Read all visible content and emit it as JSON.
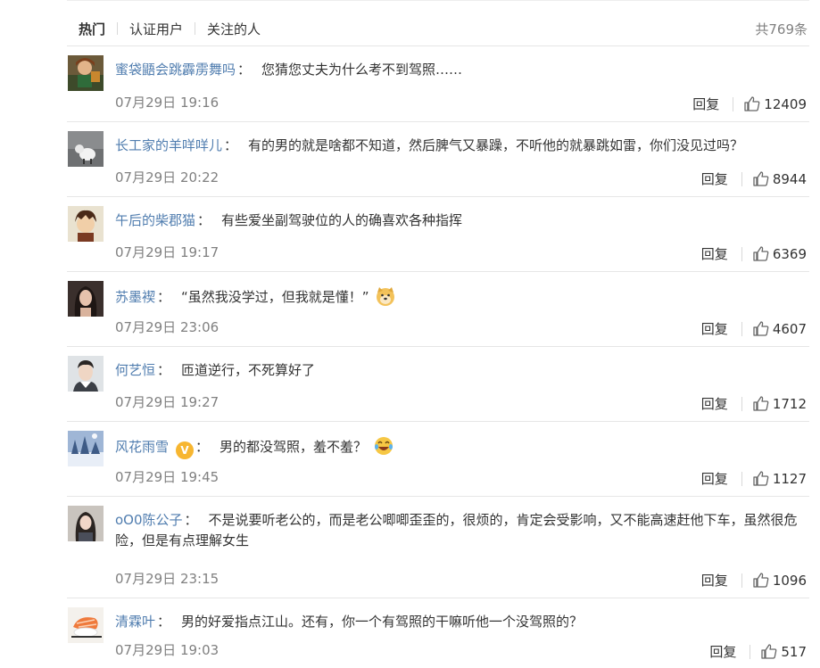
{
  "tabs": [
    {
      "label": "热门",
      "active": true
    },
    {
      "label": "认证用户",
      "active": false
    },
    {
      "label": "关注的人",
      "active": false
    }
  ],
  "total_count": "共769条",
  "reply_label": "回复",
  "comments": [
    {
      "user": "蜜袋鼯会跳霹雳舞吗",
      "colon": "：",
      "text": "您猜您丈夫为什么考不到驾照……",
      "time": "07月29日 19:16",
      "likes": "12409",
      "avatar": "illustrated-character-avatar"
    },
    {
      "user": "长工家的羊咩咩儿",
      "colon": "：",
      "text": "有的男的就是啥都不知道，然后脾气又暴躁，不听他的就暴跳如雷，你们没见过吗？",
      "time": "07月29日 20:22",
      "likes": "8944",
      "avatar": "sheep-figure-avatar"
    },
    {
      "user": "午后的柴郡猫",
      "colon": "：",
      "text": "有些爱坐副驾驶位的人的确喜欢各种指挥",
      "time": "07月29日 19:17",
      "likes": "6369",
      "avatar": "anime-boy-avatar"
    },
    {
      "user": "苏墨褉",
      "colon": "：",
      "text": "“虽然我没学过，但我就是懂！”",
      "time": "07月29日 23:06",
      "likes": "4607",
      "avatar": "woman-portrait-avatar",
      "emoji": "doge-emoji"
    },
    {
      "user": "何艺恒",
      "colon": "：",
      "text": "匝道逆行，不死算好了",
      "time": "07月29日 19:27",
      "likes": "1712",
      "avatar": "man-portrait-avatar"
    },
    {
      "user": "风花雨雪",
      "colon": "：",
      "text": "男的都没驾照，羞不羞？",
      "time": "07月29日 19:45",
      "likes": "1127",
      "avatar": "winter-forest-avatar",
      "verified_badge": "V",
      "emoji": "laughing-tears-emoji"
    },
    {
      "user": "oO0陈公子",
      "colon": "：",
      "text": "不是说要听老公的，而是老公唧唧歪歪的，很烦的，肯定会受影响，又不能高速赶他下车，虽然很危险，但是有点理解女生",
      "time": "07月29日 23:15",
      "likes": "1096",
      "avatar": "girl-portrait-avatar"
    },
    {
      "user": "清霖叶",
      "colon": "：",
      "text": "男的好爱指点江山。还有，你一个有驾照的干嘛听他一个没驾照的？",
      "time": "07月29日 19:03",
      "likes": "517",
      "avatar": "shrimp-sushi-avatar"
    }
  ],
  "colors": {
    "link": "#507daf",
    "meta": "#808080",
    "verified": "#f7b630"
  }
}
